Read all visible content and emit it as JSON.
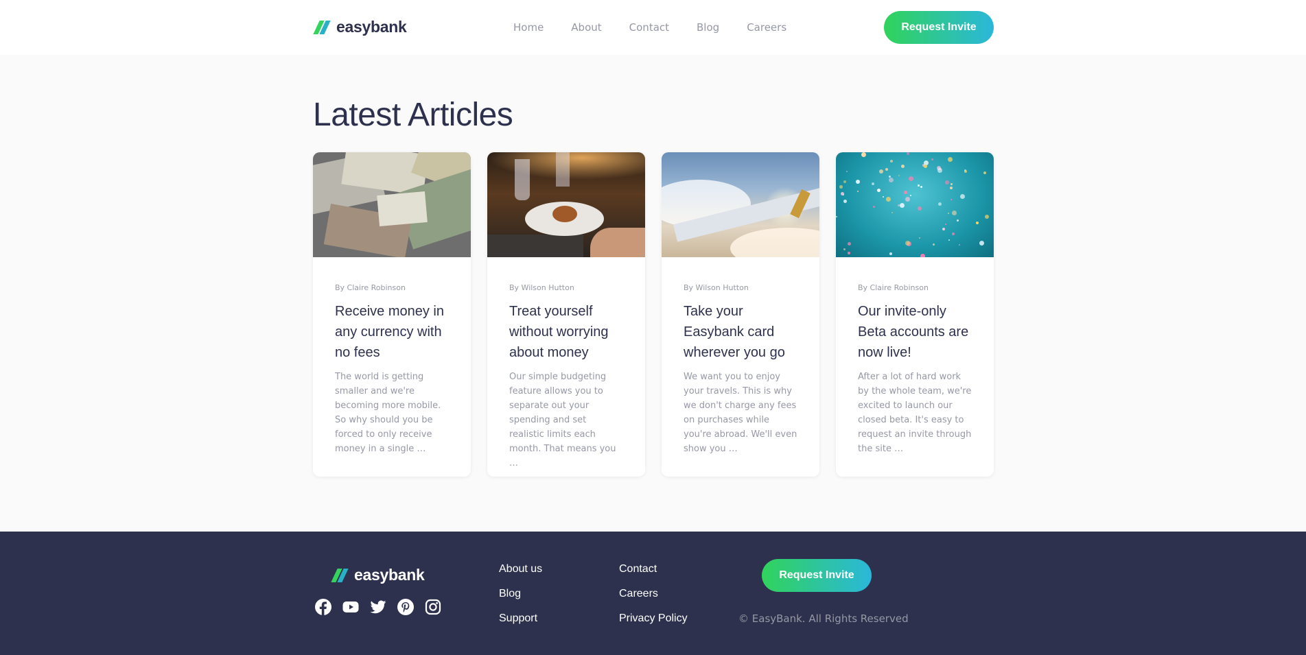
{
  "brand": {
    "name": "easybank",
    "accent_green": "#31d35c",
    "accent_cyan": "#2bb7da",
    "dark_blue": "#2d314d",
    "grayish_blue": "#9698a6"
  },
  "header": {
    "nav": [
      {
        "label": "Home"
      },
      {
        "label": "About"
      },
      {
        "label": "Contact"
      },
      {
        "label": "Blog"
      },
      {
        "label": "Careers"
      }
    ],
    "cta_label": "Request Invite"
  },
  "main": {
    "title": "Latest Articles",
    "articles": [
      {
        "author": "By Claire Robinson",
        "title": "Receive money in any currency with no fees",
        "excerpt": "The world is getting smaller and we're becoming more mobile. So why should you be forced to only receive money in a single …",
        "image": "currency-notes"
      },
      {
        "author": "By Wilson Hutton",
        "title": "Treat yourself without worrying about money",
        "excerpt": "Our simple budgeting feature allows you to separate out your spending and set realistic limits each month. That means you …",
        "image": "restaurant-dinner"
      },
      {
        "author": "By Wilson Hutton",
        "title": "Take your Easybank card wherever you go",
        "excerpt": "We want you to enjoy your travels. This is why we don't charge any fees on purchases while you're abroad. We'll even show you …",
        "image": "airplane-wing"
      },
      {
        "author": "By Claire Robinson",
        "title": "Our invite-only Beta accounts are now live!",
        "excerpt": "After a lot of hard work by the whole team, we're excited to launch our closed beta. It's easy to request an invite through the site …",
        "image": "confetti"
      }
    ]
  },
  "footer": {
    "social_icons": [
      "facebook-icon",
      "youtube-icon",
      "twitter-icon",
      "pinterest-icon",
      "instagram-icon"
    ],
    "links_col1": [
      {
        "label": "About us"
      },
      {
        "label": "Blog"
      },
      {
        "label": "Support"
      }
    ],
    "links_col2": [
      {
        "label": "Contact"
      },
      {
        "label": "Careers"
      },
      {
        "label": "Privacy Policy"
      }
    ],
    "cta_label": "Request Invite",
    "copyright": "© EasyBank. All Rights Reserved"
  }
}
